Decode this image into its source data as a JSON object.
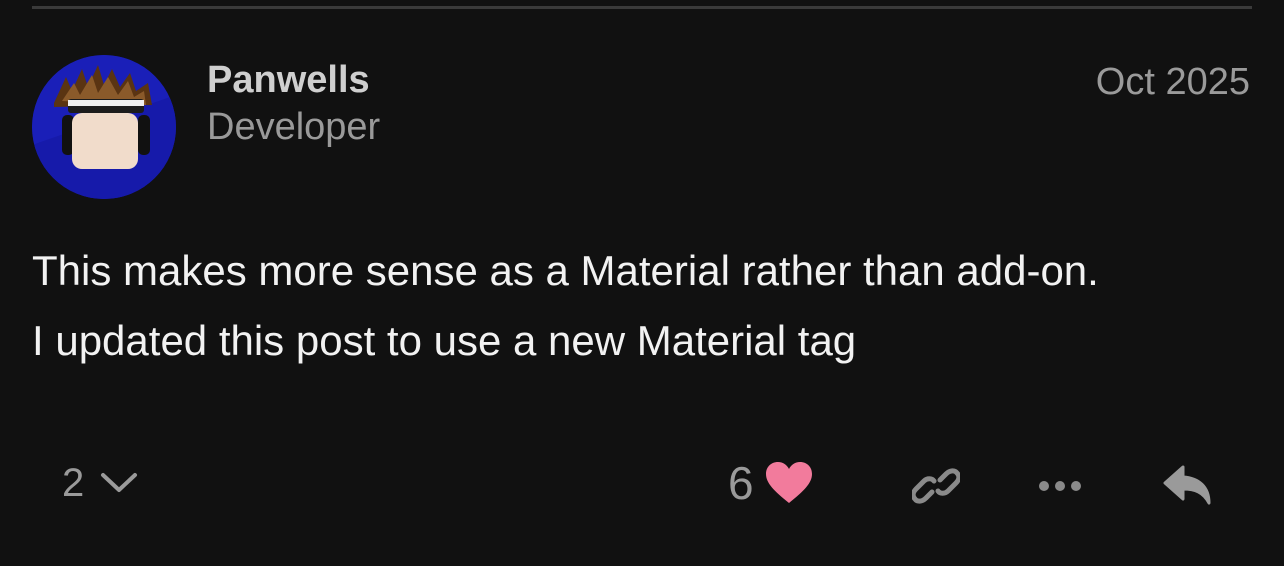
{
  "post": {
    "author": {
      "username": "Panwells",
      "title": "Developer"
    },
    "date": "Oct 2025",
    "body_lines": [
      "This makes more sense as a Material rather than add-on.",
      "I updated this post to use a new Material tag"
    ],
    "actions": {
      "reply_count": "2",
      "like_count": "6"
    }
  },
  "colors": {
    "background": "#111111",
    "heart": "#f27b9c",
    "muted": "#9a9a9a"
  },
  "icons": [
    "chevron-down-icon",
    "heart-icon",
    "link-icon",
    "more-icon",
    "reply-icon"
  ]
}
